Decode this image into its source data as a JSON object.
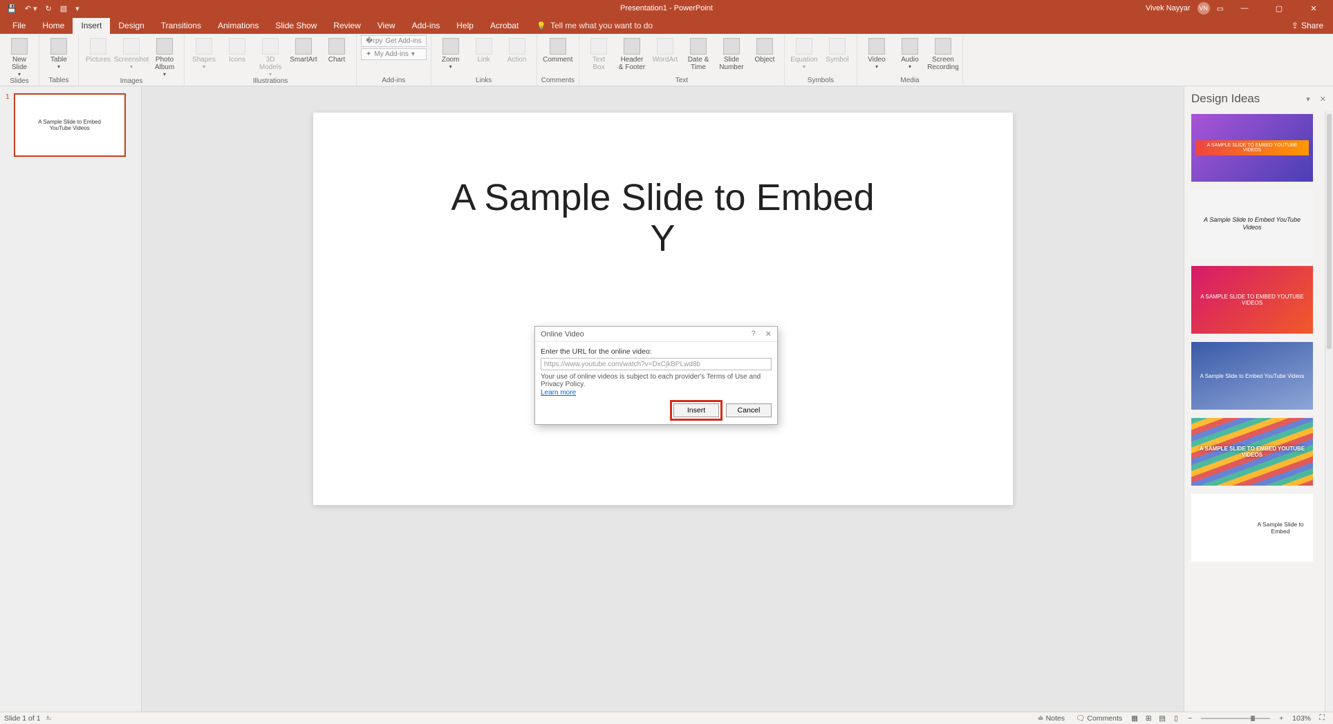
{
  "titlebar": {
    "doc_title": "Presentation1 - PowerPoint",
    "user_name": "Vivek Nayyar",
    "user_initials": "VN"
  },
  "tabs": {
    "file": "File",
    "home": "Home",
    "insert": "Insert",
    "design": "Design",
    "transitions": "Transitions",
    "animations": "Animations",
    "slideshow": "Slide Show",
    "review": "Review",
    "view": "View",
    "addins": "Add-ins",
    "help": "Help",
    "acrobat": "Acrobat",
    "tell_me": "Tell me what you want to do",
    "share": "Share"
  },
  "ribbon": {
    "groups": {
      "slides": "Slides",
      "tables": "Tables",
      "images": "Images",
      "illustrations": "Illustrations",
      "addins": "Add-ins",
      "links": "Links",
      "comments": "Comments",
      "text": "Text",
      "symbols": "Symbols",
      "media": "Media"
    },
    "btn": {
      "new_slide": "New\nSlide",
      "table": "Table",
      "pictures": "Pictures",
      "screenshot": "Screenshot",
      "photo_album": "Photo\nAlbum",
      "shapes": "Shapes",
      "icons": "Icons",
      "models3d": "3D\nModels",
      "smartart": "SmartArt",
      "chart": "Chart",
      "get_addins": "Get Add-ins",
      "my_addins": "My Add-ins",
      "zoom": "Zoom",
      "link": "Link",
      "action": "Action",
      "comment": "Comment",
      "textbox": "Text\nBox",
      "header_footer": "Header\n& Footer",
      "wordart": "WordArt",
      "date_time": "Date &\nTime",
      "slide_number": "Slide\nNumber",
      "object": "Object",
      "equation": "Equation",
      "symbol": "Symbol",
      "video": "Video",
      "audio": "Audio",
      "screen_recording": "Screen\nRecording"
    }
  },
  "thumb": {
    "num": "1",
    "text": "A Sample Slide to Embed\nYouTube Videos"
  },
  "slide": {
    "title": "A Sample Slide to Embed\nY"
  },
  "dialog": {
    "title": "Online Video",
    "label": "Enter the URL for the online video:",
    "url_value": "https://www.youtube.com/watch?v=DxCjkBPLwd8b",
    "terms": "Your use of online videos is subject to each provider's Terms of Use and Privacy Policy.",
    "learn_more": "Learn more",
    "insert": "Insert",
    "cancel": "Cancel"
  },
  "design_pane": {
    "title": "Design Ideas",
    "idea_text_caps": "A SAMPLE SLIDE TO EMBED YOUTUBE VIDEOS",
    "idea_text_serif": "A Sample Slide to Embed YouTube Videos",
    "idea_text_small": "A SAMPLE SLIDE TO EMBED YOUTUBE VIDEOS",
    "idea_text_blur": "A Sample Slide to Embed YouTube Videos",
    "idea_text_partial": "A Sample Slide to Embed"
  },
  "status": {
    "slide_of": "Slide 1 of 1",
    "notes": "Notes",
    "comments": "Comments",
    "zoom": "103%"
  }
}
